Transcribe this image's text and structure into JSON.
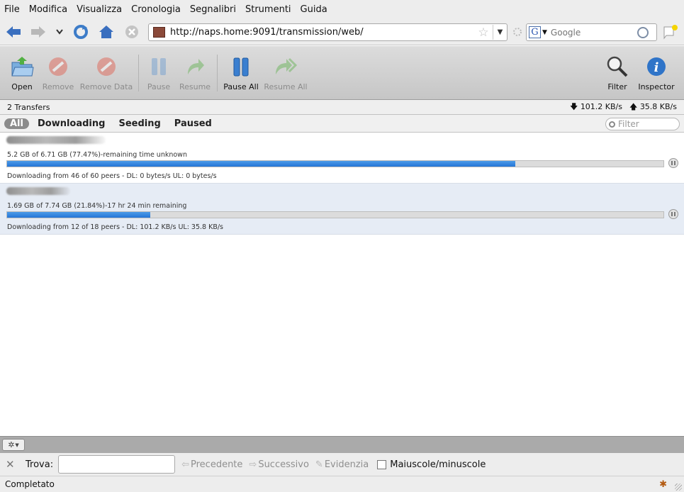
{
  "menu": [
    {
      "first": "F",
      "rest": "ile"
    },
    {
      "first": "M",
      "rest": "odifica"
    },
    {
      "first": "V",
      "rest": "isualizza"
    },
    {
      "first": "C",
      "rest": "ronologia"
    },
    {
      "first": "Se",
      "u": "g",
      "rest": "nalibri"
    },
    {
      "first": "S",
      "rest": "trumenti"
    },
    {
      "first": "G",
      "rest": "uida"
    }
  ],
  "menu_labels": [
    "File",
    "Modifica",
    "Visualizza",
    "Cronologia",
    "Segnalibri",
    "Strumenti",
    "Guida"
  ],
  "address": {
    "url": "http://naps.home:9091/transmission/web/"
  },
  "search": {
    "placeholder": "Google",
    "engine_letter": "G"
  },
  "toolbar": {
    "open": "Open",
    "remove": "Remove",
    "remove_data": "Remove Data",
    "pause": "Pause",
    "resume": "Resume",
    "pause_all": "Pause All",
    "resume_all": "Resume All",
    "filter": "Filter",
    "inspector": "Inspector"
  },
  "status": {
    "transfers": "2 Transfers",
    "down": "101.2 KB/s",
    "up": "35.8 KB/s"
  },
  "filters": {
    "all": "All",
    "downloading": "Downloading",
    "seeding": "Seeding",
    "paused": "Paused",
    "filter_placeholder": "Filter"
  },
  "torrents": [
    {
      "progress_text": "5.2 GB of 6.71 GB (77.47%)-remaining time unknown",
      "percent": 77.47,
      "peers_text": "Downloading from 46 of 60 peers - DL: 0 bytes/s UL: 0 bytes/s"
    },
    {
      "progress_text": "1.69 GB of 7.74 GB (21.84%)-17 hr 24 min remaining",
      "percent": 21.84,
      "peers_text": "Downloading from 12 of 18 peers - DL: 101.2 KB/s UL: 35.8 KB/s"
    }
  ],
  "findbar": {
    "label": "Trova:",
    "prev": "Precedente",
    "next": "Successivo",
    "highlight": "Evidenzia",
    "match_case": "Maiuscole/minuscole"
  },
  "statusbar": {
    "text": "Completato"
  },
  "colors": {
    "progress": "#2475d6",
    "selected_row": "#e6ecf5",
    "toolbar": "#cfcfcf"
  }
}
